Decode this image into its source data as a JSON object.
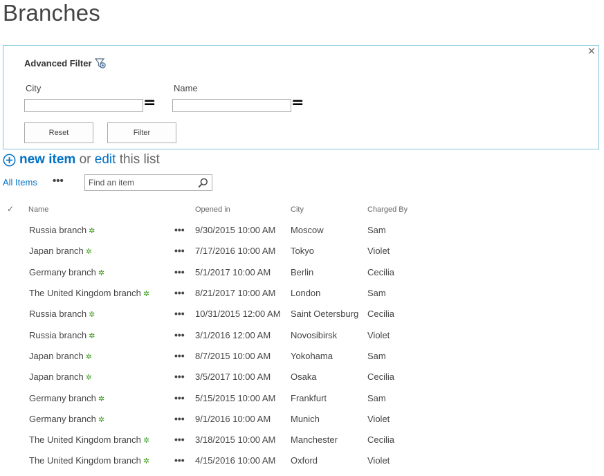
{
  "page": {
    "title": "Branches"
  },
  "filter": {
    "heading": "Advanced Filter",
    "fields": [
      {
        "label": "City",
        "value": "",
        "operator": "="
      },
      {
        "label": "Name",
        "value": "",
        "operator": "="
      }
    ],
    "reset_label": "Reset",
    "filter_label": "Filter",
    "close_glyph": "✕"
  },
  "actions": {
    "new_item": "new item",
    "or_text": "or",
    "edit": "edit",
    "this_list": "this list"
  },
  "toolbar": {
    "view": "All Items",
    "ellipsis": "•••",
    "search_placeholder": "Find an item"
  },
  "table": {
    "check_glyph": "✓",
    "columns": [
      "Name",
      "Opened in",
      "City",
      "Charged By"
    ],
    "rows": [
      {
        "name": "Russia branch",
        "opened": "9/30/2015 10:00 AM",
        "city": "Moscow",
        "charged": "Sam"
      },
      {
        "name": "Japan branch",
        "opened": "7/17/2016 10:00 AM",
        "city": "Tokyo",
        "charged": "Violet"
      },
      {
        "name": "Germany branch",
        "opened": "5/1/2017 10:00 AM",
        "city": "Berlin",
        "charged": "Cecilia"
      },
      {
        "name": "The United Kingdom branch",
        "opened": "8/21/2017 10:00 AM",
        "city": "London",
        "charged": "Sam"
      },
      {
        "name": "Russia branch",
        "opened": "10/31/2015 12:00 AM",
        "city": "Saint Oetersburg",
        "charged": "Cecilia"
      },
      {
        "name": "Russia branch",
        "opened": "3/1/2016 12:00 AM",
        "city": "Novosibirsk",
        "charged": "Violet"
      },
      {
        "name": "Japan branch",
        "opened": "8/7/2015 10:00 AM",
        "city": "Yokohama",
        "charged": "Sam"
      },
      {
        "name": "Japan branch",
        "opened": "3/5/2017 10:00 AM",
        "city": "Osaka",
        "charged": "Cecilia"
      },
      {
        "name": "Germany branch",
        "opened": "5/15/2015 10:00 AM",
        "city": "Frankfurt",
        "charged": "Sam"
      },
      {
        "name": "Germany branch",
        "opened": "9/1/2016 10:00 AM",
        "city": "Munich",
        "charged": "Violet"
      },
      {
        "name": "The United Kingdom branch",
        "opened": "3/18/2015 10:00 AM",
        "city": "Manchester",
        "charged": "Cecilia"
      },
      {
        "name": "The United Kingdom branch",
        "opened": "4/15/2016 10:00 AM",
        "city": "Oxford",
        "charged": "Violet"
      }
    ],
    "new_badge": "✲",
    "row_menu": "•••"
  },
  "colors": {
    "accent": "#0072c6",
    "panel_border": "#7fc5d9",
    "new_badge": "#3a9b1a"
  }
}
